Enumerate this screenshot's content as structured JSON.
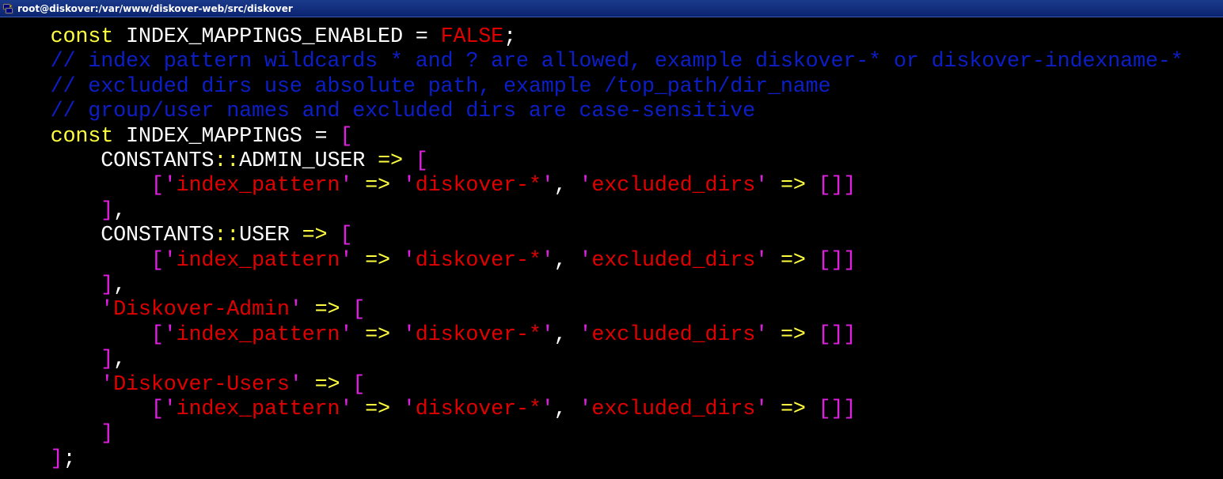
{
  "window": {
    "title": "root@diskover:/var/www/diskover-web/src/diskover",
    "icon": "putty-terminal-icon"
  },
  "colors": {
    "keyword": "#ffff40",
    "identifier": "#ffffff",
    "string_and_literal": "#e00000",
    "bracket": "#e020e0",
    "comment": "#0c1ec8",
    "background": "#000000"
  },
  "terminal": {
    "lines": [
      {
        "tokens": [
          {
            "t": "    ",
            "c": "w"
          },
          {
            "t": "const",
            "c": "y"
          },
          {
            "t": " INDEX_MAPPINGS_ENABLED ",
            "c": "w"
          },
          {
            "t": "=",
            "c": "w"
          },
          {
            "t": " ",
            "c": "w"
          },
          {
            "t": "FALSE",
            "c": "r"
          },
          {
            "t": ";",
            "c": "w"
          }
        ]
      },
      {
        "tokens": [
          {
            "t": "    // index pattern wildcards * and ? are allowed, example diskover-* or diskover-indexname-*",
            "c": "c"
          }
        ]
      },
      {
        "tokens": [
          {
            "t": "    // excluded dirs use absolute path, example /top_path/dir_name",
            "c": "c"
          }
        ]
      },
      {
        "tokens": [
          {
            "t": "    // group/user names and excluded dirs are case-sensitive",
            "c": "c"
          }
        ]
      },
      {
        "tokens": [
          {
            "t": "    ",
            "c": "w"
          },
          {
            "t": "const",
            "c": "y"
          },
          {
            "t": " INDEX_MAPPINGS ",
            "c": "w"
          },
          {
            "t": "=",
            "c": "w"
          },
          {
            "t": " ",
            "c": "w"
          },
          {
            "t": "[",
            "c": "m"
          }
        ]
      },
      {
        "tokens": [
          {
            "t": "        CONSTANTS",
            "c": "w"
          },
          {
            "t": "::",
            "c": "y"
          },
          {
            "t": "ADMIN_USER ",
            "c": "w"
          },
          {
            "t": "=>",
            "c": "y"
          },
          {
            "t": " ",
            "c": "w"
          },
          {
            "t": "[",
            "c": "m"
          }
        ]
      },
      {
        "tokens": [
          {
            "t": "            ",
            "c": "w"
          },
          {
            "t": "['",
            "c": "m"
          },
          {
            "t": "index_pattern",
            "c": "r"
          },
          {
            "t": "'",
            "c": "m"
          },
          {
            "t": " ",
            "c": "w"
          },
          {
            "t": "=>",
            "c": "y"
          },
          {
            "t": " ",
            "c": "w"
          },
          {
            "t": "'",
            "c": "m"
          },
          {
            "t": "diskover-*",
            "c": "r"
          },
          {
            "t": "'",
            "c": "m"
          },
          {
            "t": ", ",
            "c": "w"
          },
          {
            "t": "'",
            "c": "m"
          },
          {
            "t": "excluded_dirs",
            "c": "r"
          },
          {
            "t": "'",
            "c": "m"
          },
          {
            "t": " ",
            "c": "w"
          },
          {
            "t": "=>",
            "c": "y"
          },
          {
            "t": " ",
            "c": "w"
          },
          {
            "t": "[]]",
            "c": "m"
          }
        ]
      },
      {
        "tokens": [
          {
            "t": "        ",
            "c": "w"
          },
          {
            "t": "]",
            "c": "m"
          },
          {
            "t": ",",
            "c": "w"
          }
        ]
      },
      {
        "tokens": [
          {
            "t": "        CONSTANTS",
            "c": "w"
          },
          {
            "t": "::",
            "c": "y"
          },
          {
            "t": "USER ",
            "c": "w"
          },
          {
            "t": "=>",
            "c": "y"
          },
          {
            "t": " ",
            "c": "w"
          },
          {
            "t": "[",
            "c": "m"
          }
        ]
      },
      {
        "tokens": [
          {
            "t": "            ",
            "c": "w"
          },
          {
            "t": "['",
            "c": "m"
          },
          {
            "t": "index_pattern",
            "c": "r"
          },
          {
            "t": "'",
            "c": "m"
          },
          {
            "t": " ",
            "c": "w"
          },
          {
            "t": "=>",
            "c": "y"
          },
          {
            "t": " ",
            "c": "w"
          },
          {
            "t": "'",
            "c": "m"
          },
          {
            "t": "diskover-*",
            "c": "r"
          },
          {
            "t": "'",
            "c": "m"
          },
          {
            "t": ", ",
            "c": "w"
          },
          {
            "t": "'",
            "c": "m"
          },
          {
            "t": "excluded_dirs",
            "c": "r"
          },
          {
            "t": "'",
            "c": "m"
          },
          {
            "t": " ",
            "c": "w"
          },
          {
            "t": "=>",
            "c": "y"
          },
          {
            "t": " ",
            "c": "w"
          },
          {
            "t": "[]]",
            "c": "m"
          }
        ]
      },
      {
        "tokens": [
          {
            "t": "        ",
            "c": "w"
          },
          {
            "t": "]",
            "c": "m"
          },
          {
            "t": ",",
            "c": "w"
          }
        ]
      },
      {
        "tokens": [
          {
            "t": "        ",
            "c": "w"
          },
          {
            "t": "'",
            "c": "m"
          },
          {
            "t": "Diskover-Admin",
            "c": "r"
          },
          {
            "t": "'",
            "c": "m"
          },
          {
            "t": " ",
            "c": "w"
          },
          {
            "t": "=>",
            "c": "y"
          },
          {
            "t": " ",
            "c": "w"
          },
          {
            "t": "[",
            "c": "m"
          }
        ]
      },
      {
        "tokens": [
          {
            "t": "            ",
            "c": "w"
          },
          {
            "t": "['",
            "c": "m"
          },
          {
            "t": "index_pattern",
            "c": "r"
          },
          {
            "t": "'",
            "c": "m"
          },
          {
            "t": " ",
            "c": "w"
          },
          {
            "t": "=>",
            "c": "y"
          },
          {
            "t": " ",
            "c": "w"
          },
          {
            "t": "'",
            "c": "m"
          },
          {
            "t": "diskover-*",
            "c": "r"
          },
          {
            "t": "'",
            "c": "m"
          },
          {
            "t": ", ",
            "c": "w"
          },
          {
            "t": "'",
            "c": "m"
          },
          {
            "t": "excluded_dirs",
            "c": "r"
          },
          {
            "t": "'",
            "c": "m"
          },
          {
            "t": " ",
            "c": "w"
          },
          {
            "t": "=>",
            "c": "y"
          },
          {
            "t": " ",
            "c": "w"
          },
          {
            "t": "[]]",
            "c": "m"
          }
        ]
      },
      {
        "tokens": [
          {
            "t": "        ",
            "c": "w"
          },
          {
            "t": "]",
            "c": "m"
          },
          {
            "t": ",",
            "c": "w"
          }
        ]
      },
      {
        "tokens": [
          {
            "t": "        ",
            "c": "w"
          },
          {
            "t": "'",
            "c": "m"
          },
          {
            "t": "Diskover-Users",
            "c": "r"
          },
          {
            "t": "'",
            "c": "m"
          },
          {
            "t": " ",
            "c": "w"
          },
          {
            "t": "=>",
            "c": "y"
          },
          {
            "t": " ",
            "c": "w"
          },
          {
            "t": "[",
            "c": "m"
          }
        ]
      },
      {
        "tokens": [
          {
            "t": "            ",
            "c": "w"
          },
          {
            "t": "['",
            "c": "m"
          },
          {
            "t": "index_pattern",
            "c": "r"
          },
          {
            "t": "'",
            "c": "m"
          },
          {
            "t": " ",
            "c": "w"
          },
          {
            "t": "=>",
            "c": "y"
          },
          {
            "t": " ",
            "c": "w"
          },
          {
            "t": "'",
            "c": "m"
          },
          {
            "t": "diskover-*",
            "c": "r"
          },
          {
            "t": "'",
            "c": "m"
          },
          {
            "t": ", ",
            "c": "w"
          },
          {
            "t": "'",
            "c": "m"
          },
          {
            "t": "excluded_dirs",
            "c": "r"
          },
          {
            "t": "'",
            "c": "m"
          },
          {
            "t": " ",
            "c": "w"
          },
          {
            "t": "=>",
            "c": "y"
          },
          {
            "t": " ",
            "c": "w"
          },
          {
            "t": "[]]",
            "c": "m"
          }
        ]
      },
      {
        "tokens": [
          {
            "t": "        ",
            "c": "w"
          },
          {
            "t": "]",
            "c": "m"
          }
        ]
      },
      {
        "tokens": [
          {
            "t": "    ",
            "c": "w"
          },
          {
            "t": "]",
            "c": "m"
          },
          {
            "t": ";",
            "c": "w"
          }
        ]
      }
    ]
  }
}
